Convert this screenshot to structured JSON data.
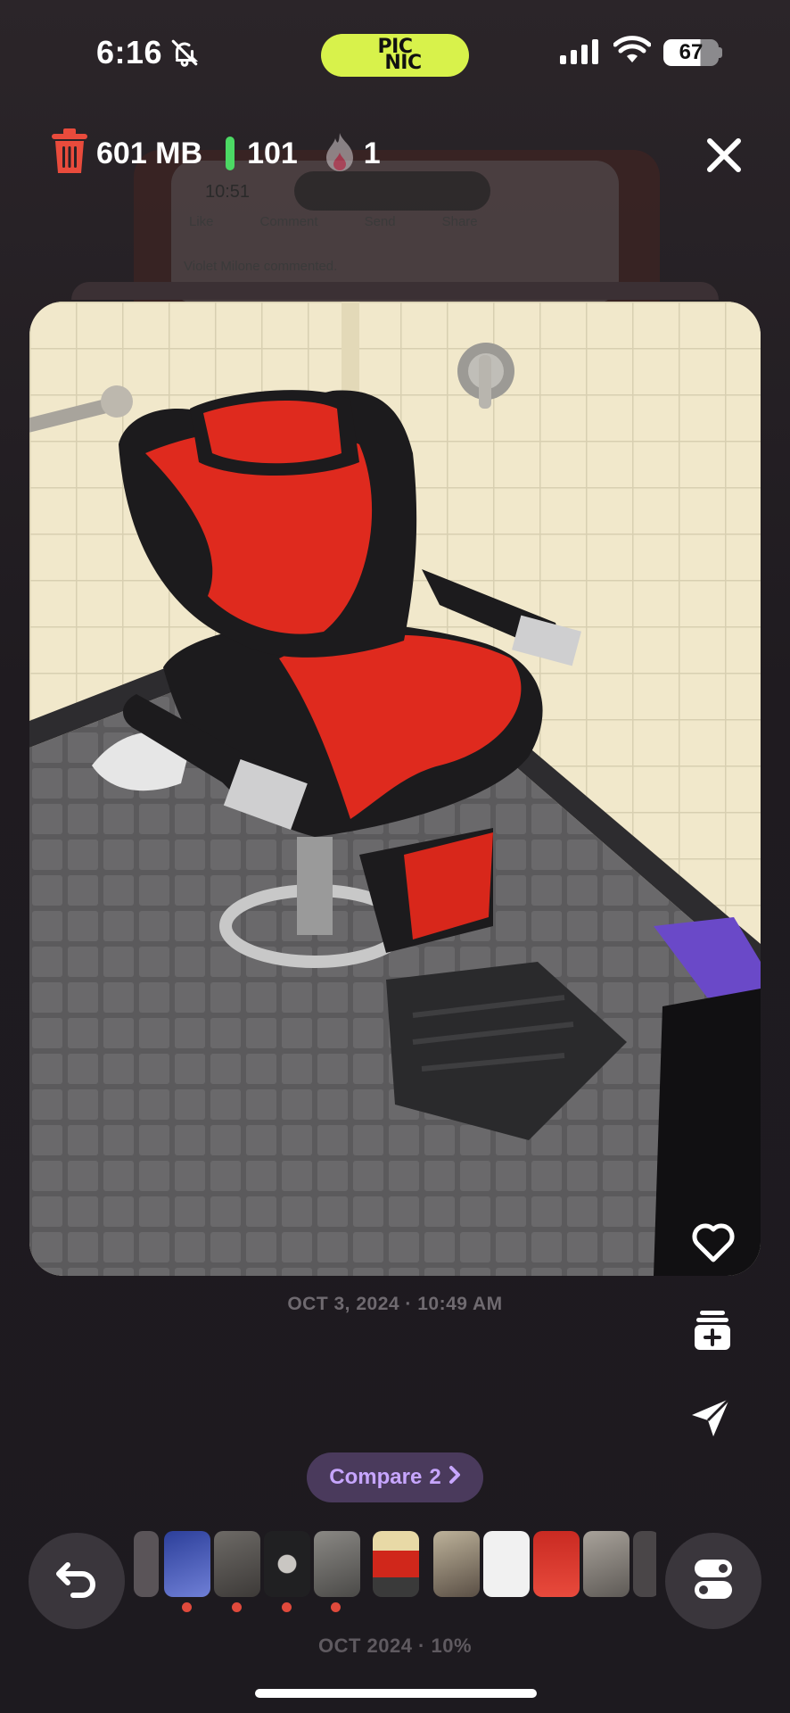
{
  "status_bar": {
    "time": "6:16",
    "battery": "67",
    "bell_icon": "bell-slash-icon",
    "signal_icon": "cellular-signal-icon",
    "wifi_icon": "wifi-icon"
  },
  "app": {
    "logo_line1": "PIC",
    "logo_line2": "NIC",
    "accent": "#d8f24b"
  },
  "stats": {
    "storage": "601 MB",
    "kept": "101",
    "streak": "1",
    "trash_color": "#e94b3c",
    "kept_color": "#4cd964"
  },
  "background_card": {
    "time": "10:51",
    "actions": [
      "Like",
      "Comment",
      "Send",
      "Share"
    ],
    "comment": "Violet Milone commented."
  },
  "photo": {
    "subject": "red and black barber chair in tiled room",
    "date": "OCT 3, 2024 · 10:49 AM"
  },
  "side_actions": [
    "heart-icon",
    "add-to-album-icon",
    "send-icon"
  ],
  "compare": {
    "label": "Compare",
    "count": "2",
    "color": "#c7a6ff"
  },
  "thumbnails": {
    "count": 13,
    "marked": [
      1,
      2,
      3,
      4
    ]
  },
  "footer": {
    "label": "OCT 2024 · 10%"
  },
  "bottom_buttons": [
    "undo-icon",
    "toggle-icon"
  ]
}
